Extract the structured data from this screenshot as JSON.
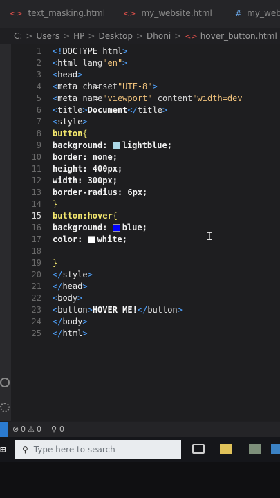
{
  "tabs": [
    {
      "label": "text_masking.html",
      "icon": "html-file-icon"
    },
    {
      "label": "my_website.html",
      "icon": "html-file-icon"
    },
    {
      "label": "my_web",
      "icon": "hash-file-icon"
    }
  ],
  "breadcrumb": [
    "C:",
    "Users",
    "HP",
    "Desktop",
    "Dhoni",
    "hover_button.html"
  ],
  "editor": {
    "active_line": 15,
    "lines": [
      {
        "n": "1",
        "parts": [
          [
            "tag",
            "<!"
          ],
          [
            "tagname",
            "DOCTYPE "
          ],
          [
            "attr",
            "html"
          ],
          [
            "tag",
            ">"
          ]
        ]
      },
      {
        "n": "2",
        "parts": [
          [
            "tag",
            "<"
          ],
          [
            "tagname",
            "html "
          ],
          [
            "attr",
            "lang"
          ],
          [
            "code",
            "="
          ],
          [
            "str",
            "\"en\""
          ],
          [
            "tag",
            ">"
          ]
        ]
      },
      {
        "n": "3",
        "parts": [
          [
            "tag",
            "<"
          ],
          [
            "tagname",
            "head"
          ],
          [
            "tag",
            ">"
          ]
        ]
      },
      {
        "n": "4",
        "parts": [
          [
            "code",
            "    "
          ],
          [
            "tag",
            "<"
          ],
          [
            "tagname",
            "meta "
          ],
          [
            "attr",
            "charset"
          ],
          [
            "code",
            "="
          ],
          [
            "str",
            "\"UTF-8\""
          ],
          [
            "tag",
            ">"
          ]
        ]
      },
      {
        "n": "5",
        "parts": [
          [
            "code",
            "    "
          ],
          [
            "tag",
            "<"
          ],
          [
            "tagname",
            "meta "
          ],
          [
            "attr",
            "name"
          ],
          [
            "code",
            "="
          ],
          [
            "str",
            "\"viewport\" "
          ],
          [
            "attr",
            "content"
          ],
          [
            "code",
            "="
          ],
          [
            "str",
            "\"width=dev"
          ]
        ]
      },
      {
        "n": "6",
        "parts": [
          [
            "code",
            "    "
          ],
          [
            "tag",
            "<"
          ],
          [
            "tagname",
            "title"
          ],
          [
            "tag",
            ">"
          ],
          [
            "txt",
            "Document"
          ],
          [
            "tag",
            "</"
          ],
          [
            "tagname",
            "title"
          ],
          [
            "tag",
            ">"
          ]
        ]
      },
      {
        "n": "7",
        "parts": [
          [
            "code",
            "    "
          ],
          [
            "tag",
            "<"
          ],
          [
            "tagname",
            "style"
          ],
          [
            "tag",
            ">"
          ]
        ]
      },
      {
        "n": "8",
        "parts": [
          [
            "code",
            "        "
          ],
          [
            "sel",
            "button"
          ],
          [
            "brace",
            "{"
          ]
        ]
      },
      {
        "n": "9",
        "parts": [
          [
            "code",
            "            "
          ],
          [
            "prop",
            "background: "
          ],
          [
            "swatch",
            "#add8e6"
          ],
          [
            "val",
            "lightblue;"
          ]
        ]
      },
      {
        "n": "10",
        "parts": [
          [
            "code",
            "            "
          ],
          [
            "prop",
            "border: "
          ],
          [
            "val",
            "none;"
          ]
        ]
      },
      {
        "n": "11",
        "parts": [
          [
            "code",
            "            "
          ],
          [
            "prop",
            "height: "
          ],
          [
            "val",
            "400px;"
          ]
        ]
      },
      {
        "n": "12",
        "parts": [
          [
            "code",
            "            "
          ],
          [
            "prop",
            "width: "
          ],
          [
            "val",
            "300px;"
          ]
        ]
      },
      {
        "n": "13",
        "parts": [
          [
            "code",
            "            "
          ],
          [
            "prop",
            "border-radius: "
          ],
          [
            "val",
            "6px;"
          ]
        ]
      },
      {
        "n": "14",
        "parts": [
          [
            "code",
            "        "
          ],
          [
            "brace",
            "}"
          ]
        ]
      },
      {
        "n": "15",
        "parts": [
          [
            "code",
            "        "
          ],
          [
            "sel",
            "button:hover"
          ],
          [
            "brace",
            "{"
          ]
        ]
      },
      {
        "n": "16",
        "parts": [
          [
            "code",
            "            "
          ],
          [
            "prop",
            "background: "
          ],
          [
            "swatch",
            "#0000ff"
          ],
          [
            "val",
            "blue;"
          ]
        ]
      },
      {
        "n": "17",
        "parts": [
          [
            "code",
            "            "
          ],
          [
            "prop",
            "color: "
          ],
          [
            "swatch",
            "#ffffff"
          ],
          [
            "val",
            "white;"
          ]
        ]
      },
      {
        "n": "18",
        "parts": [
          [
            "code",
            ""
          ]
        ]
      },
      {
        "n": "19",
        "parts": [
          [
            "code",
            "        "
          ],
          [
            "brace",
            "}"
          ]
        ]
      },
      {
        "n": "20",
        "parts": [
          [
            "code",
            "    "
          ],
          [
            "tag",
            "</"
          ],
          [
            "tagname",
            "style"
          ],
          [
            "tag",
            ">"
          ]
        ]
      },
      {
        "n": "21",
        "parts": [
          [
            "tag",
            "</"
          ],
          [
            "tagname",
            "head"
          ],
          [
            "tag",
            ">"
          ]
        ]
      },
      {
        "n": "22",
        "parts": [
          [
            "tag",
            "<"
          ],
          [
            "tagname",
            "body"
          ],
          [
            "tag",
            ">"
          ]
        ]
      },
      {
        "n": "23",
        "parts": [
          [
            "code",
            "    "
          ],
          [
            "tag",
            "<"
          ],
          [
            "tagname",
            "button"
          ],
          [
            "tag",
            ">"
          ],
          [
            "txt",
            "HOVER ME!"
          ],
          [
            "tag",
            "</"
          ],
          [
            "tagname",
            "button"
          ],
          [
            "tag",
            ">"
          ]
        ]
      },
      {
        "n": "24",
        "parts": [
          [
            "tag",
            "</"
          ],
          [
            "tagname",
            "body"
          ],
          [
            "tag",
            ">"
          ]
        ]
      },
      {
        "n": "25",
        "parts": [
          [
            "tag",
            "</"
          ],
          [
            "tagname",
            "html"
          ],
          [
            "tag",
            ">"
          ]
        ]
      }
    ]
  },
  "status": {
    "errors": "0",
    "warnings": "0",
    "ports": "0"
  },
  "taskbar": {
    "search_placeholder": "Type here to search"
  },
  "colors": {
    "accent": "#4fa3ff",
    "html_icon": "#e0504b",
    "selector": "#f2e66d"
  }
}
